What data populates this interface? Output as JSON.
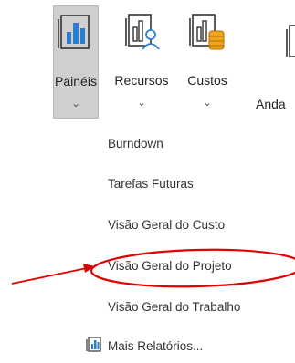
{
  "ribbon": {
    "buttons": [
      {
        "label": "Painéis",
        "icon": "dashboard-bar-chart-icon",
        "selected": true
      },
      {
        "label": "Recursos",
        "icon": "resource-chart-person-icon",
        "selected": false
      },
      {
        "label": "Custos",
        "icon": "cost-chart-coins-icon",
        "selected": false
      }
    ],
    "partial_label": "Anda",
    "dropdown_glyph": "⌄"
  },
  "menu": {
    "items": [
      {
        "label": "Burndown"
      },
      {
        "label": "Tarefas Futuras"
      },
      {
        "label": "Visão Geral do Custo"
      },
      {
        "label": "Visão Geral do Projeto",
        "highlighted": true
      },
      {
        "label": "Visão Geral do Trabalho"
      },
      {
        "label": "Mais Relatórios...",
        "icon": "report-icon"
      }
    ]
  },
  "annotation": {
    "arrow_color": "#e00000",
    "circle_color": "#e00000"
  },
  "colors": {
    "selected_button_bg": "#cfcfcf",
    "icon_blue": "#2b7cd3",
    "icon_orange": "#f0a41b"
  }
}
